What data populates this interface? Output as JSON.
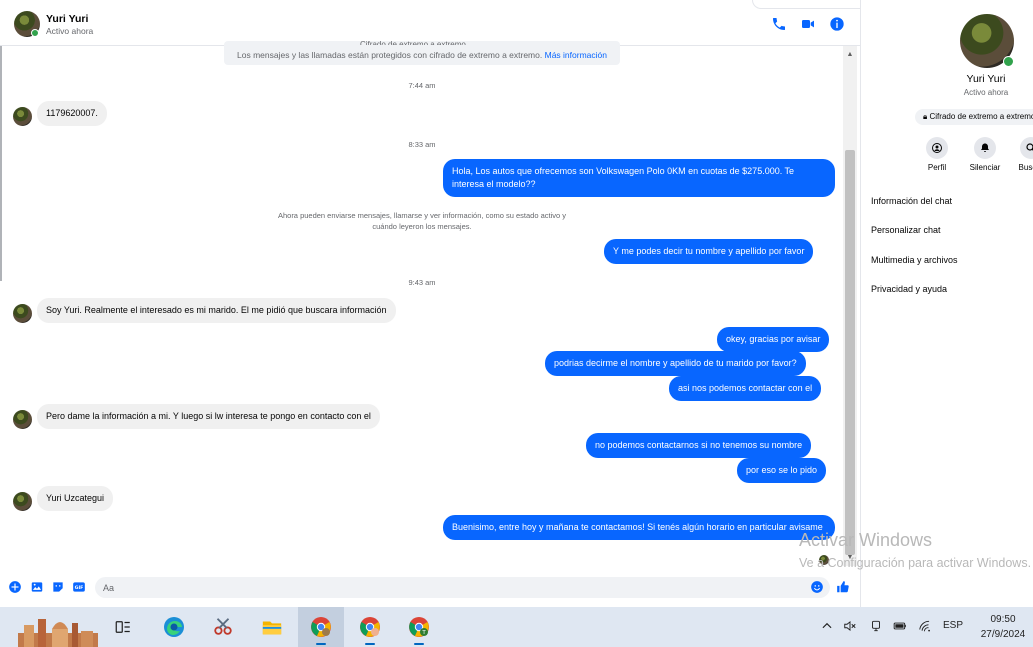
{
  "chat": {
    "contact_name": "Yuri Yuri",
    "contact_status": "Activo ahora",
    "encryption_notice_cut": "Cifrado de extremo a extremo",
    "encryption_notice": "Los mensajes y las llamadas están protegidos con cifrado de extremo a extremo.",
    "encryption_link": "Más información",
    "timestamps": [
      "7:44 am",
      "8:33 am",
      "9:43 am"
    ],
    "system_message": "Ahora pueden enviarse mensajes, llamarse y ver información, como su estado activo y cuándo leyeron los mensajes.",
    "messages": [
      {
        "dir": "in",
        "text": "1179620007."
      },
      {
        "dir": "out",
        "text": "Hola, Los autos que ofrecemos son Volkswagen Polo 0KM en cuotas de $275.000. Te interesa el modelo??"
      },
      {
        "dir": "out",
        "text": "Y me podes decir tu nombre y apellido por favor"
      },
      {
        "dir": "in",
        "text": "Soy Yuri. Realmente el interesado es mi marido. El me pidió que buscara información"
      },
      {
        "dir": "out",
        "text": "okey, gracias por avisar"
      },
      {
        "dir": "out",
        "text": "podrias decirme el nombre y apellido de tu marido por favor?"
      },
      {
        "dir": "out",
        "text": "asi nos podemos contactar con el"
      },
      {
        "dir": "in",
        "text": "Pero dame la información a mi. Y luego si lw interesa te pongo en contacto con el"
      },
      {
        "dir": "out",
        "text": "no podemos contactarnos si no tenemos su nombre"
      },
      {
        "dir": "out",
        "text": "por eso se lo pido"
      },
      {
        "dir": "in",
        "text": "Yuri Uzcategui"
      },
      {
        "dir": "out",
        "text": "Buenisimo, entre hoy y mañana te contactamos! Si tenés algún horario en particular avisame"
      }
    ],
    "composer_placeholder": "Aa"
  },
  "panel": {
    "name": "Yuri Yuri",
    "status": "Activo ahora",
    "encryption_badge": "Cifrado de extremo a extremo",
    "actions": [
      {
        "label": "Perfil",
        "icon": "profile-icon"
      },
      {
        "label": "Silenciar",
        "icon": "bell-icon"
      },
      {
        "label": "Buscar",
        "icon": "search-icon"
      }
    ],
    "links": [
      "Información del chat",
      "Personalizar chat",
      "Multimedia y archivos",
      "Privacidad y ayuda"
    ]
  },
  "watermark": {
    "title": "Activar Windows",
    "subtitle": "Ve a Configuración para activar Windows."
  },
  "taskbar": {
    "language": "ESP",
    "time": "09:50",
    "date": "27/9/2024"
  },
  "colors": {
    "accent": "#0866ff",
    "bubble_in": "#f0f0f0",
    "online": "#31a24c",
    "taskbar": "#dfe7f2"
  }
}
